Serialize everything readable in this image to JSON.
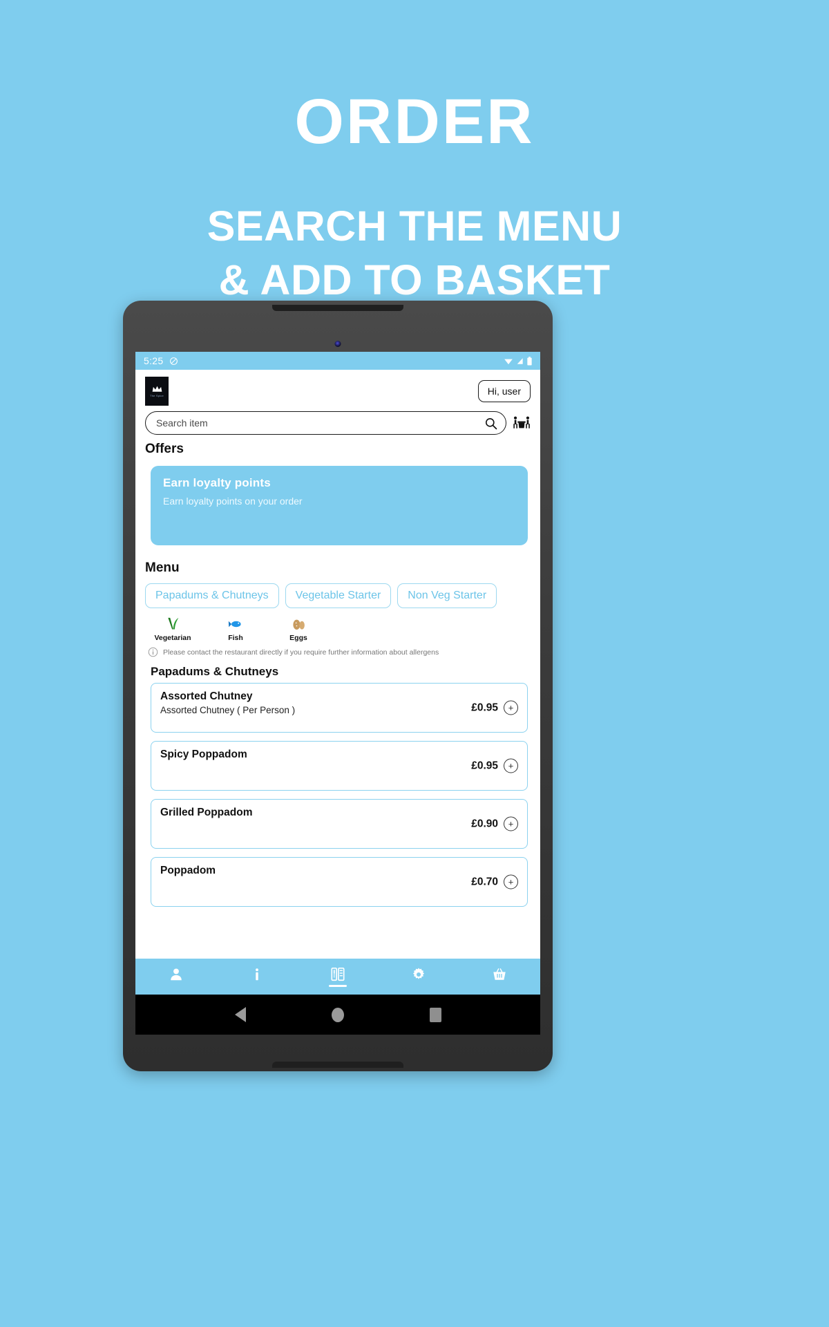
{
  "promo": {
    "title": "ORDER",
    "subtitle_line1": "SEARCH THE MENU",
    "subtitle_line2": "& ADD TO BASKET"
  },
  "colors": {
    "brand": "#7fcdee",
    "accent_border": "#8bd2ef",
    "chip_text": "#6cc4e8",
    "white": "#ffffff"
  },
  "statusbar": {
    "time": "5:25",
    "mute_icon": "do-not-disturb-icon",
    "wifi_icon": "wifi-icon",
    "signal_icon": "signal-icon",
    "battery_icon": "battery-icon"
  },
  "header": {
    "logo_name": "restaurant-logo",
    "logo_caption": "The Spice",
    "greeting_button": "Hi, user"
  },
  "search": {
    "placeholder": "Search item",
    "value": "",
    "search_icon": "search-icon",
    "table_booking_icon": "table-booking-icon"
  },
  "offers": {
    "section_title": "Offers",
    "cards": [
      {
        "title": "Earn loyalty points",
        "description": "Earn loyalty points on your order"
      }
    ]
  },
  "menu": {
    "section_title": "Menu",
    "categories": [
      {
        "label": "Papadums & Chutneys",
        "selected": true
      },
      {
        "label": "Vegetable Starter",
        "selected": false
      },
      {
        "label": "Non Veg Starter",
        "selected": false
      }
    ],
    "legend": [
      {
        "label": "Vegetarian",
        "icon": "leaf-icon"
      },
      {
        "label": "Fish",
        "icon": "fish-icon"
      },
      {
        "label": "Eggs",
        "icon": "egg-icon"
      }
    ],
    "allergen_note": "Please contact the restaurant directly if you require further information about allergens",
    "allergen_icon": "info-icon",
    "current_category": "Papadums & Chutneys",
    "items": [
      {
        "name": "Assorted Chutney",
        "description": "Assorted Chutney ( Per Person )",
        "price": "£0.95",
        "add_label": "+"
      },
      {
        "name": "Spicy Poppadom",
        "description": "",
        "price": "£0.95",
        "add_label": "+"
      },
      {
        "name": "Grilled Poppadom",
        "description": "",
        "price": "£0.90",
        "add_label": "+"
      },
      {
        "name": "Poppadom",
        "description": "",
        "price": "£0.70",
        "add_label": "+"
      }
    ]
  },
  "bottom_nav": {
    "items": [
      {
        "name": "account",
        "icon": "person-icon",
        "active": false
      },
      {
        "name": "info",
        "icon": "info-letter-icon",
        "active": false
      },
      {
        "name": "menu",
        "icon": "menu-board-icon",
        "active": true
      },
      {
        "name": "settings",
        "icon": "gear-icon",
        "active": false
      },
      {
        "name": "basket",
        "icon": "basket-icon",
        "active": false
      }
    ]
  },
  "android_nav": {
    "back": "back-triangle-icon",
    "home": "home-circle-icon",
    "recents": "recents-square-icon"
  }
}
